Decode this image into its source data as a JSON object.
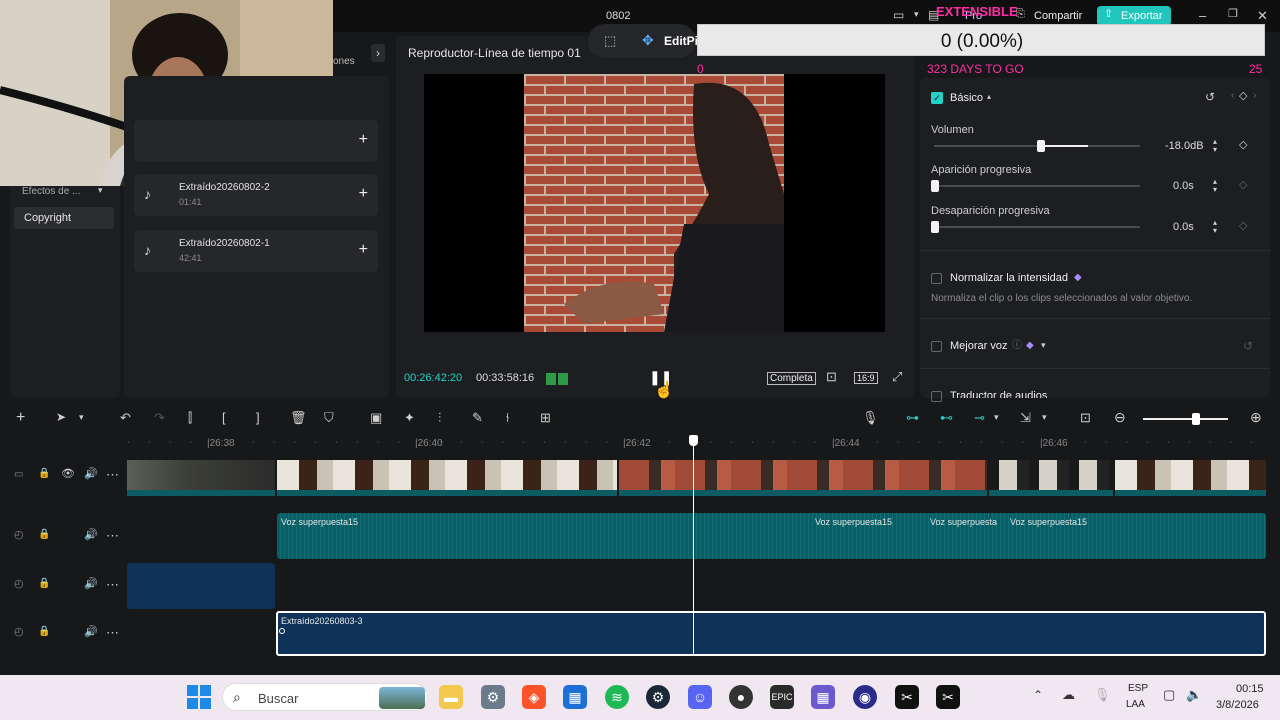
{
  "titlebar": {
    "project_name": "0802",
    "pro_label": "Pro",
    "share_label": "Compartir",
    "export_label": "Exportar"
  },
  "extension": {
    "title": "EXTENSIBLE",
    "counter": "0 (0.00%)",
    "left_value": "0",
    "days_label": "323 DAYS TO GO",
    "right_value": "25"
  },
  "topbar": {
    "edit_label": "EditPi",
    "tab_partial": "ones"
  },
  "player": {
    "title": "Reproductor-Línea de tiempo 01",
    "current_time": "00:26:42:20",
    "total_time": "00:33:58:16",
    "complete_label": "Completa",
    "ratio_label": "16:9"
  },
  "left_nav": {
    "effects_label": "Efectos de ...",
    "copyright_label": "Copyright"
  },
  "media": {
    "items": [
      {
        "name": "Extraído20260802-2",
        "duration": "01:41"
      },
      {
        "name": "Extraído20260802-1",
        "duration": "42:41"
      }
    ]
  },
  "audio_panel": {
    "basic_label": "Básico",
    "volume_label": "Volumen",
    "volume_value": "-18.0dB",
    "fade_in_label": "Aparición progresiva",
    "fade_in_value": "0.0s",
    "fade_out_label": "Desaparición progresiva",
    "fade_out_value": "0.0s",
    "normalize_label": "Normalizar la intensidad",
    "normalize_desc": "Normaliza el clip o los clips seleccionados al valor objetivo.",
    "enhance_label": "Mejorar voz",
    "translate_label": "Traductor de audios"
  },
  "ruler": {
    "ticks": [
      "|26:38",
      "|26:40",
      "|26:42",
      "|26:44",
      "|26:46"
    ]
  },
  "tracks": {
    "voice_clips": [
      "Voz superpuesta15",
      "Voz superpuesta15",
      "Voz superpuesta",
      "Voz superpuesta15"
    ],
    "main_clip": "Extraído20260803-3"
  },
  "taskbar": {
    "search_placeholder": "Buscar",
    "lang1": "ESP",
    "lang2": "LAA",
    "time": "00:15",
    "date": "3/8/2026"
  },
  "colors": {
    "accent": "#22d3c5",
    "clip_blue": "#0f3358",
    "wave": "#0d5c63",
    "pink": "#ff2fa6"
  }
}
